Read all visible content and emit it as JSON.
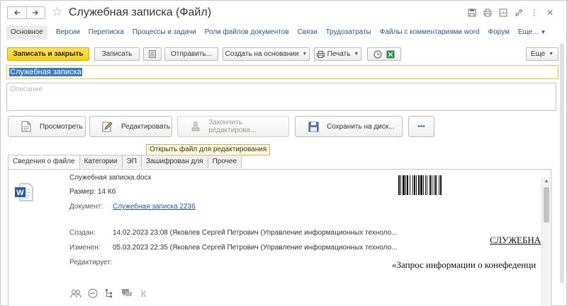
{
  "window": {
    "title": "Служебная записка (Файл)"
  },
  "navbar": {
    "items": [
      {
        "label": "Основное",
        "active": true
      },
      {
        "label": "Версии"
      },
      {
        "label": "Переписка"
      },
      {
        "label": "Процессы и задачи"
      },
      {
        "label": "Роли файлов документов"
      },
      {
        "label": "Связи"
      },
      {
        "label": "Трудозатраты"
      },
      {
        "label": "Файлы с комментариями word"
      },
      {
        "label": "Форум"
      }
    ],
    "more_label": "Еще..."
  },
  "toolbar": {
    "save_close_label": "Записать и закрыть",
    "save_label": "Записать",
    "send_label": "Отправить...",
    "create_basis_label": "Создать на основании",
    "print_label": "Печать",
    "more_label": "Еще"
  },
  "form": {
    "name_value": "Служебная записка",
    "description_placeholder": "Описание"
  },
  "actions": {
    "view_label": "Просмотреть",
    "edit_label": "Редактировать",
    "finish_edit_label": "Закончить редактирова...",
    "save_disk_label": "Сохранить на диск...",
    "more_label": "•••"
  },
  "tooltip": {
    "text": "Открыть файл для редактирования"
  },
  "subtabs": {
    "items": [
      "Сведения о файле",
      "Категории",
      "ЭП",
      "Зашифрован для",
      "Прочее"
    ]
  },
  "file_info": {
    "file_name": "Служебная записка.docx",
    "size_label": "Размер: 14 Кб",
    "document_label": "Документ:",
    "document_link": "Служебная записка 2236",
    "created_label": "Создан:",
    "created_value": "14.02.2023 23:08 (Яковлев Сергей Петрович (Управление информационных техноло...",
    "modified_label": "Изменен:",
    "modified_value": "05.03.2023 22:35 (Яковлев Сергей Петрович (Управление информационных техноло...",
    "editing_label": "Редактирует:"
  },
  "preview": {
    "title": "СЛУЖЕБНА",
    "subtitle": "«Запрос информации о конефеденци"
  },
  "colors": {
    "primary_button": "#f7cf1a",
    "link": "#1c5aa6",
    "selection": "#3a79c6",
    "tooltip_bg": "#fff8d8"
  },
  "icons": {
    "bottom": [
      "users-icon",
      "signature-icon",
      "tree-icon",
      "comments-icon",
      "k-icon"
    ]
  }
}
